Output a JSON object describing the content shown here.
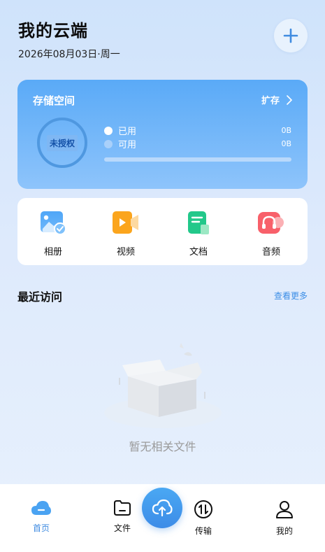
{
  "header": {
    "title": "我的云端",
    "date": "2026年08月03日·周一"
  },
  "storage": {
    "title": "存储空间",
    "expand_label": "扩存",
    "status_badge": "未授权",
    "used_label": "已用",
    "used_value": "0B",
    "available_label": "可用",
    "available_value": "0B",
    "usage_fraction": 0
  },
  "quick_access": [
    {
      "label": "相册",
      "icon": "photo-album-icon"
    },
    {
      "label": "视频",
      "icon": "video-icon"
    },
    {
      "label": "文档",
      "icon": "document-icon"
    },
    {
      "label": "音频",
      "icon": "audio-icon"
    }
  ],
  "recent": {
    "title": "最近访问",
    "more_label": "查看更多",
    "empty_text": "暂无相关文件"
  },
  "tabbar": {
    "items": [
      {
        "label": "首页",
        "icon": "cloud-icon",
        "active": true
      },
      {
        "label": "文件",
        "icon": "folder-icon"
      },
      {
        "label": "传输",
        "icon": "transfer-icon"
      },
      {
        "label": "我的",
        "icon": "user-icon"
      }
    ],
    "center_icon": "cloud-upload-icon"
  },
  "colors": {
    "accent": "#3f8be0",
    "card_gradient_top": "#5aaaf7",
    "card_gradient_bottom": "#8ec4fb"
  }
}
